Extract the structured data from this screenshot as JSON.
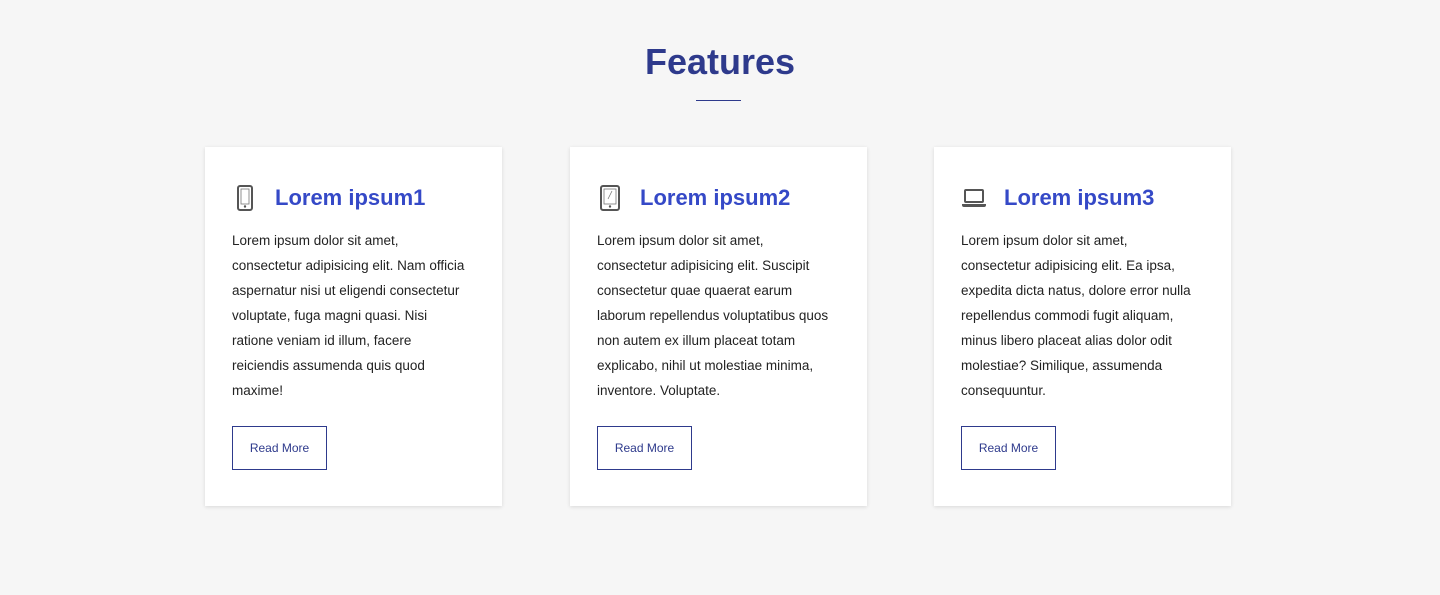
{
  "section": {
    "title": "Features"
  },
  "colors": {
    "title": "#2e3a8c",
    "card_title": "#3549c7",
    "button_border": "#2e3a8c",
    "background": "#f6f6f6",
    "card_background": "#ffffff"
  },
  "cards": [
    {
      "icon": "mobile-phone-icon",
      "title": "Lorem ipsum1",
      "text": "Lorem ipsum dolor sit amet, consectetur adipisicing elit. Nam officia aspernatur nisi ut eligendi consectetur voluptate, fuga magni quasi. Nisi ratione veniam id illum, facere reiciendis assumenda quis quod maxime!",
      "button_label": "Read More"
    },
    {
      "icon": "tablet-icon",
      "title": "Lorem ipsum2",
      "text": "Lorem ipsum dolor sit amet, consectetur adipisicing elit. Suscipit consectetur quae quaerat earum laborum repellendus voluptatibus quos non autem ex illum placeat totam explicabo, nihil ut molestiae minima, inventore. Voluptate.",
      "button_label": "Read More"
    },
    {
      "icon": "laptop-icon",
      "title": "Lorem ipsum3",
      "text": "Lorem ipsum dolor sit amet, consectetur adipisicing elit. Ea ipsa, expedita dicta natus, dolore error nulla repellendus commodi fugit aliquam, minus libero placeat alias dolor odit molestiae? Similique, assumenda consequuntur.",
      "button_label": "Read More"
    }
  ]
}
